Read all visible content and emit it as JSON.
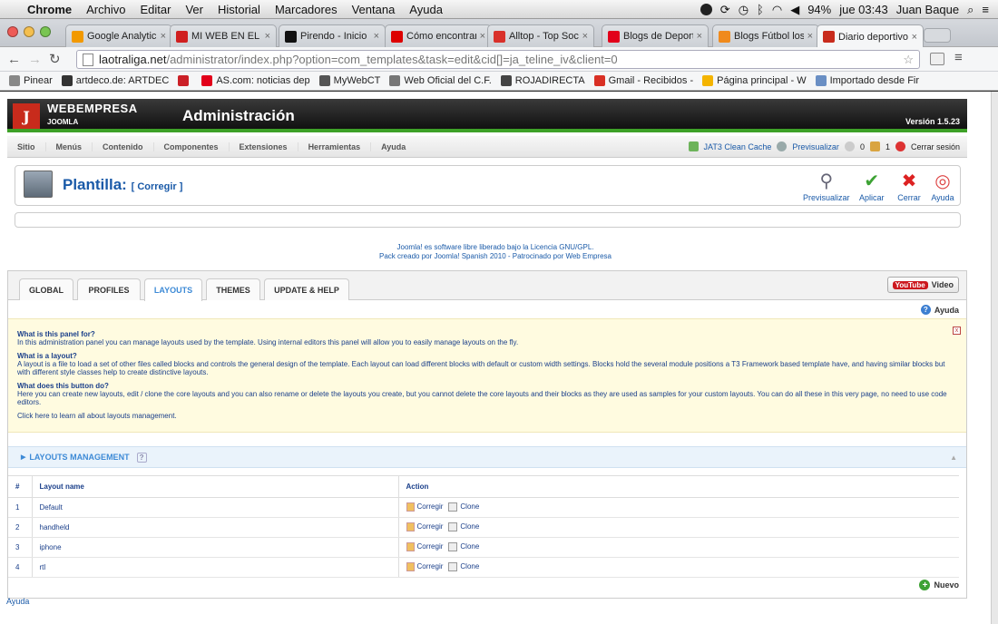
{
  "os_menubar": {
    "app": "Chrome",
    "items": [
      "Archivo",
      "Editar",
      "Ver",
      "Historial",
      "Marcadores",
      "Ventana",
      "Ayuda"
    ],
    "battery": "94%",
    "clock": "jue 03:43",
    "user": "Juan Baque"
  },
  "tabs": [
    {
      "title": "Google Analytic",
      "color": "#f29900",
      "icon": "analytics-icon",
      "active": false
    },
    {
      "title": "MI WEB EN EL M",
      "color": "#d01f1f",
      "icon": "w-icon",
      "active": false
    },
    {
      "title": "Pirendo - Inicio",
      "color": "#111111",
      "icon": "p-icon",
      "active": false
    },
    {
      "title": "Cómo encontrar",
      "color": "#dd0000",
      "icon": "red-dot-icon",
      "active": false
    },
    {
      "title": "Alltop - Top Soc",
      "color": "#d9302a",
      "icon": "a-icon",
      "active": false
    },
    {
      "title": "Blogs de Deport",
      "color": "#e2001a",
      "icon": "as-icon",
      "active": false
    },
    {
      "title": "Blogs Fútbol los",
      "color": "#f08a1c",
      "icon": "b-icon",
      "active": false
    },
    {
      "title": "Diario deportivo",
      "color": "#c82b1c",
      "icon": "joomla-icon",
      "active": true
    }
  ],
  "address": {
    "host": "laotraliga.net",
    "path": "/administrator/index.php?option=com_templates&task=edit&cid[]=ja_teline_iv&client=0"
  },
  "bookmarks": [
    {
      "label": "Pinear",
      "color": "#888888"
    },
    {
      "label": "artdeco.de: ARTDEC",
      "color": "#333333"
    },
    {
      "label": "",
      "color": "#cb2027"
    },
    {
      "label": "AS.com: noticias dep",
      "color": "#e2001a"
    },
    {
      "label": "MyWebCT",
      "color": "#555555"
    },
    {
      "label": "Web Oficial del C.F.",
      "color": "#777777"
    },
    {
      "label": "ROJADIRECTA",
      "color": "#444444"
    },
    {
      "label": "Gmail - Recibidos -",
      "color": "#d93025"
    },
    {
      "label": "Página principal - W",
      "color": "#f4b400"
    },
    {
      "label": "Importado desde Fir",
      "color": "#6a8fc4"
    }
  ],
  "joomla": {
    "brand": "WEBEMPRESA",
    "brand_sub": "JOOMLA",
    "admin_title": "Administración",
    "version": "Versión 1.5.23",
    "menu": [
      "Sitio",
      "Menús",
      "Contenido",
      "Componentes",
      "Extensiones",
      "Herramientas",
      "Ayuda"
    ],
    "status": {
      "cache": "JAT3 Clean Cache",
      "preview": "Previsualizar",
      "count1": "0",
      "count2": "1",
      "logout": "Cerrar sesión"
    },
    "page_title": "Plantilla:",
    "page_subtitle": "[ Corregir ]",
    "toolbar": {
      "preview": "Previsualizar",
      "apply": "Aplicar",
      "close": "Cerrar",
      "help": "Ayuda"
    },
    "credits1": "Joomla! es software libre liberado bajo la Licencia GNU/GPL.",
    "credits2": "Pack creado por Joomla! Spanish 2010 - Patrocinado por Web Empresa",
    "footer": "Ayuda"
  },
  "panel": {
    "tabs": [
      "GLOBAL",
      "PROFILES",
      "LAYOUTS",
      "THEMES",
      "UPDATE & HELP"
    ],
    "active_tab": "LAYOUTS",
    "video_label": "Video",
    "youtube": "YouTube",
    "help_label": "Ayuda",
    "help": {
      "q1": "What is this panel for?",
      "a1": "In this administration panel you can manage layouts used by the template. Using internal editors this panel will allow you to easily manage layouts on the fly.",
      "q2": "What is a layout?",
      "a2": "A layout is a file to load a set of other files called blocks and controls the general design of the template. Each layout can load different blocks with default or custom width settings. Blocks hold the several module positions a T3 Framework based template have, and having similar blocks but with different style classes help to create distinctive layouts.",
      "q3": "What does this button do?",
      "a3": "Here you can create new layouts, edit / clone the core layouts and you can also rename or delete the layouts you create, but you cannot delete the core layouts and their blocks as they are used as samples for your custom layouts. You can do all these in this very page, no need to use code editors.",
      "link": "Click here to learn all about layouts management."
    },
    "section_title": "LAYOUTS MANAGEMENT",
    "section_q": "?",
    "table": {
      "headers": [
        "#",
        "Layout name",
        "Action"
      ],
      "rows": [
        {
          "n": "1",
          "name": "Default"
        },
        {
          "n": "2",
          "name": "handheld"
        },
        {
          "n": "3",
          "name": "iphone"
        },
        {
          "n": "4",
          "name": "rtl"
        }
      ],
      "edit_label": "Corregir",
      "clone_label": "Clone"
    },
    "new_label": "Nuevo"
  }
}
